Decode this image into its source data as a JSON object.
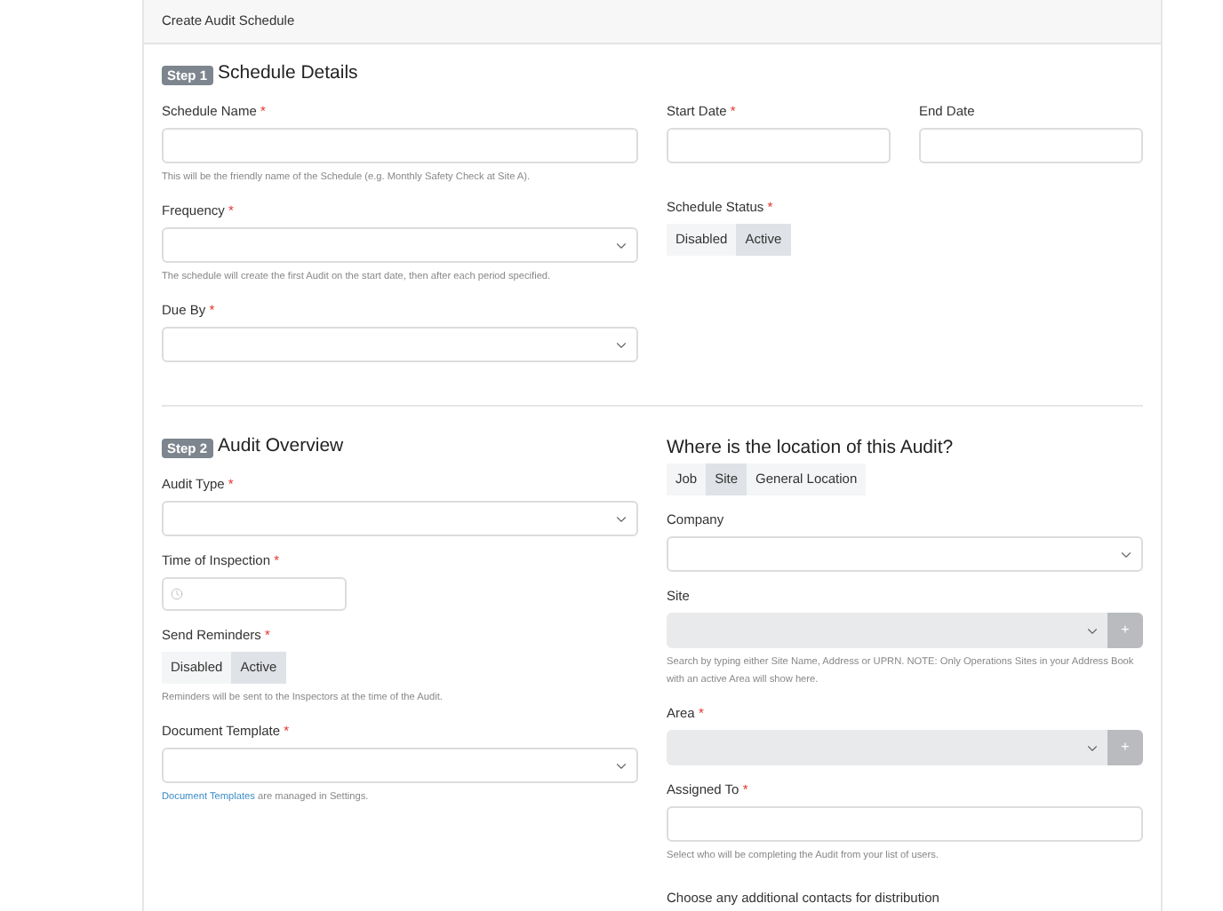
{
  "card": {
    "title": "Create Audit Schedule"
  },
  "required_mark": "*",
  "step1": {
    "badge": "Step 1",
    "title": "Schedule Details",
    "left": [
      {
        "kind": "text",
        "label": "Schedule Name",
        "required": true,
        "help": "This will be the friendly name of the Schedule (e.g. Monthly Safety Check at Site A)."
      },
      {
        "kind": "select",
        "label": "Frequency",
        "required": true,
        "help": "The schedule will create the first Audit on the start date, then after each period specified."
      },
      {
        "kind": "select",
        "label": "Due By",
        "required": true
      }
    ],
    "dates": [
      {
        "kind": "text",
        "label": "Start Date",
        "required": true
      },
      {
        "kind": "text",
        "label": "End Date",
        "required": false
      }
    ],
    "right": [
      {
        "kind": "toggle",
        "label": "Schedule Status",
        "required": true,
        "options": [
          {
            "label": "Disabled",
            "selected": false
          },
          {
            "label": "Active",
            "selected": true
          }
        ]
      }
    ]
  },
  "step2": {
    "badge": "Step 2",
    "title": "Audit Overview",
    "left": [
      {
        "kind": "select",
        "label": "Audit Type",
        "required": true
      },
      {
        "kind": "time",
        "label": "Time of Inspection",
        "required": true
      },
      {
        "kind": "toggle",
        "label": "Send Reminders",
        "required": true,
        "options": [
          {
            "label": "Disabled",
            "selected": false
          },
          {
            "label": "Active",
            "selected": true
          }
        ],
        "help": "Reminders will be sent to the Inspectors at the time of the Audit."
      },
      {
        "kind": "select",
        "label": "Document Template",
        "required": true,
        "help_link": "Document Templates",
        "help": "are managed in Settings."
      }
    ]
  },
  "location": {
    "title": "Where is the location of this Audit?",
    "tabs": [
      {
        "label": "Job",
        "selected": false
      },
      {
        "label": "Site",
        "selected": true
      },
      {
        "label": "General Location",
        "selected": false
      }
    ],
    "fields": [
      {
        "kind": "select",
        "label": "Company",
        "required": false
      },
      {
        "kind": "select_add",
        "label": "Site",
        "required": false,
        "disabled": true,
        "add_label": "+",
        "help": "Search by typing either Site Name, Address or UPRN. NOTE: Only Operations Sites in your Address Book with an active Area will show here."
      },
      {
        "kind": "select_add",
        "label": "Area",
        "required": true,
        "disabled": true,
        "add_label": "+"
      },
      {
        "kind": "text",
        "label": "Assigned To",
        "required": true,
        "help": "Select who will be completing the Audit from your list of users."
      }
    ],
    "contacts_label": "Choose any additional contacts for distribution"
  }
}
